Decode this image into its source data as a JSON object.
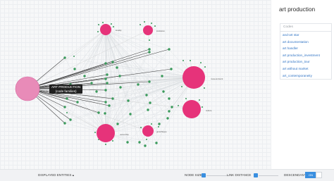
{
  "sidebar": {
    "title": "art production",
    "codes_header": "Codes",
    "codes": [
      "and-art star",
      "art documentation",
      "art handler",
      "art production_investment",
      "art production_tour",
      "art without market",
      "art_contemporaneity"
    ]
  },
  "tooltip": {
    "line1": "ART PRODUCTION",
    "line2": "(code families)"
  },
  "graph": {
    "hub_label": "art production",
    "node_color": "#e6337a",
    "hub_color": "#e88bb8",
    "leaf_color": "#3a9a5b",
    "big_nodes": [
      {
        "label": "locality"
      },
      {
        "label": "institution"
      },
      {
        "label": "museum/work"
      },
      {
        "label": "culture"
      },
      {
        "label": "ownership"
      },
      {
        "label": "growth/type"
      }
    ]
  },
  "bottom": {
    "displayed_entities": "DISPLAYED ENTITIES",
    "node_size": "NODE SIZE",
    "link_distance": "LINK DISTANCE",
    "descendants": "DESCENDANTS",
    "descendants_toggle": "ON"
  }
}
